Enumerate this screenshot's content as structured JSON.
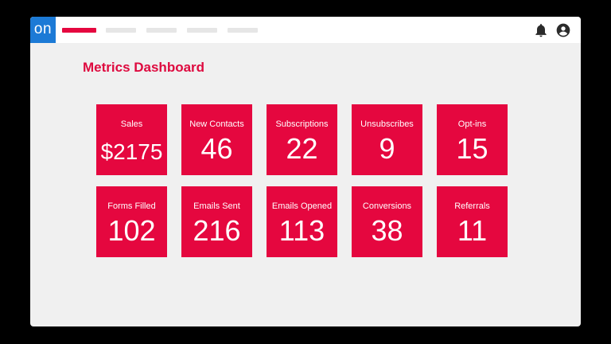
{
  "app": {
    "logo_text": "on",
    "brand_color": "#1c7ad6",
    "accent_color": "#e5073f"
  },
  "header": {
    "icons": [
      "bell-icon",
      "account-icon"
    ]
  },
  "page": {
    "title": "Metrics Dashboard"
  },
  "metrics": [
    {
      "label": "Sales",
      "value": "$2175"
    },
    {
      "label": "New Contacts",
      "value": "46"
    },
    {
      "label": "Subscriptions",
      "value": "22"
    },
    {
      "label": "Unsubscribes",
      "value": "9"
    },
    {
      "label": "Opt-ins",
      "value": "15"
    },
    {
      "label": "Forms Filled",
      "value": "102"
    },
    {
      "label": "Emails Sent",
      "value": "216"
    },
    {
      "label": "Emails Opened",
      "value": "113"
    },
    {
      "label": "Conversions",
      "value": "38"
    },
    {
      "label": "Referrals",
      "value": "11"
    }
  ]
}
